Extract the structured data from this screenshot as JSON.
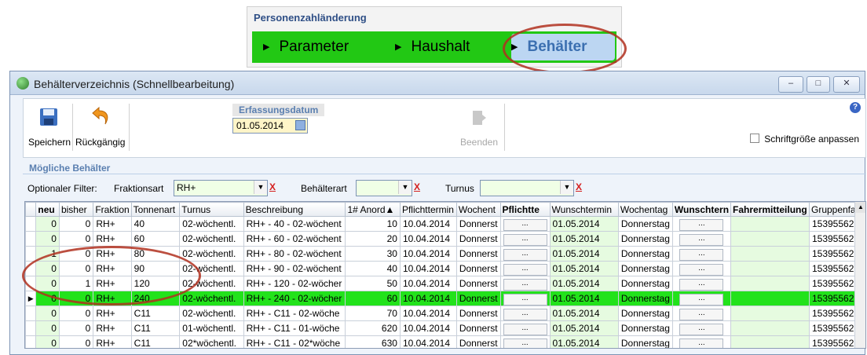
{
  "banner": {
    "title": "Personenzahländerung",
    "nav": [
      {
        "label": "Parameter"
      },
      {
        "label": "Haushalt"
      },
      {
        "label": "Behälter"
      }
    ]
  },
  "window": {
    "title": "Behälterverzeichnis (Schnellbearbeitung)",
    "controls": {
      "minimize": "–",
      "maximize": "□",
      "close": "✕"
    }
  },
  "toolbar": {
    "save_label": "Speichern",
    "undo_label": "Rückgängig",
    "exit_label": "Beenden",
    "date_label": "Erfassungsdatum",
    "date_value": "01.05.2014",
    "font_size_label": "Schriftgröße anpassen",
    "help": "?"
  },
  "section_title": "Mögliche Behälter",
  "filter": {
    "label": "Optionaler Filter:",
    "fraktionsart_label": "Fraktionsart",
    "fraktionsart_value": "RH+",
    "behaelterart_label": "Behälterart",
    "behaelterart_value": "",
    "turnus_label": "Turnus",
    "turnus_value": "",
    "clear": "X"
  },
  "grid": {
    "columns": [
      "neu",
      "bisher",
      "Fraktion",
      "Tonnenart",
      "Turnus",
      "Beschreibung",
      "1# Anord▲",
      "Pflichttermin",
      "Wochent",
      "Pflichtte",
      "Wunschtermin",
      "Wochentag",
      "Wunschtern",
      "Fahrermitteilung",
      "Gruppenfa"
    ],
    "ellipsis": "...",
    "rows": [
      {
        "neu": "0",
        "bisher": "0",
        "fraktion": "RH+",
        "tonnenart": "40",
        "turnus": "02-wöchentl.",
        "beschreibung": "RH+ - 40 - 02-wöchent",
        "anord": "10",
        "pflichttermin": "10.04.2014",
        "wochentag1": "Donnerst",
        "wunschtermin": "01.05.2014",
        "wochentag2": "Donnerstag",
        "gruppe": "15395562"
      },
      {
        "neu": "0",
        "bisher": "0",
        "fraktion": "RH+",
        "tonnenart": "60",
        "turnus": "02-wöchentl.",
        "beschreibung": "RH+ - 60 - 02-wöchent",
        "anord": "20",
        "pflichttermin": "10.04.2014",
        "wochentag1": "Donnerst",
        "wunschtermin": "01.05.2014",
        "wochentag2": "Donnerstag",
        "gruppe": "15395562"
      },
      {
        "neu": "1",
        "bisher": "0",
        "fraktion": "RH+",
        "tonnenart": "80",
        "turnus": "02-wöchentl.",
        "beschreibung": "RH+ - 80 - 02-wöchent",
        "anord": "30",
        "pflichttermin": "10.04.2014",
        "wochentag1": "Donnerst",
        "wunschtermin": "01.05.2014",
        "wochentag2": "Donnerstag",
        "gruppe": "15395562"
      },
      {
        "neu": "0",
        "bisher": "0",
        "fraktion": "RH+",
        "tonnenart": "90",
        "turnus": "02-wöchentl.",
        "beschreibung": "RH+ - 90 - 02-wöchent",
        "anord": "40",
        "pflichttermin": "10.04.2014",
        "wochentag1": "Donnerst",
        "wunschtermin": "01.05.2014",
        "wochentag2": "Donnerstag",
        "gruppe": "15395562"
      },
      {
        "neu": "0",
        "bisher": "1",
        "fraktion": "RH+",
        "tonnenart": "120",
        "turnus": "02-wöchentl.",
        "beschreibung": "RH+ - 120 - 02-wöcher",
        "anord": "50",
        "pflichttermin": "10.04.2014",
        "wochentag1": "Donnerst",
        "wunschtermin": "01.05.2014",
        "wochentag2": "Donnerstag",
        "gruppe": "15395562"
      },
      {
        "neu": "0",
        "bisher": "0",
        "fraktion": "RH+",
        "tonnenart": "240",
        "turnus": "02-wöchentl.",
        "beschreibung": "RH+ - 240 - 02-wöcher",
        "anord": "60",
        "pflichttermin": "10.04.2014",
        "wochentag1": "Donnerst",
        "wunschtermin": "01.05.2014",
        "wochentag2": "Donnerstag",
        "gruppe": "15395562",
        "selected": true
      },
      {
        "neu": "0",
        "bisher": "0",
        "fraktion": "RH+",
        "tonnenart": "C11",
        "turnus": "02-wöchentl.",
        "beschreibung": "RH+ - C11 - 02-wöche",
        "anord": "70",
        "pflichttermin": "10.04.2014",
        "wochentag1": "Donnerst",
        "wunschtermin": "01.05.2014",
        "wochentag2": "Donnerstag",
        "gruppe": "15395562"
      },
      {
        "neu": "0",
        "bisher": "0",
        "fraktion": "RH+",
        "tonnenart": "C11",
        "turnus": "01-wöchentl.",
        "beschreibung": "RH+ - C11 - 01-wöche",
        "anord": "620",
        "pflichttermin": "10.04.2014",
        "wochentag1": "Donnerst",
        "wunschtermin": "01.05.2014",
        "wochentag2": "Donnerstag",
        "gruppe": "15395562"
      },
      {
        "neu": "0",
        "bisher": "0",
        "fraktion": "RH+",
        "tonnenart": "C11",
        "turnus": "02*wöchentl.",
        "beschreibung": "RH+ - C11 - 02*wöche",
        "anord": "630",
        "pflichttermin": "10.04.2014",
        "wochentag1": "Donnerst",
        "wunschtermin": "01.05.2014",
        "wochentag2": "Donnerstag",
        "gruppe": "15395562"
      }
    ]
  },
  "colors": {
    "accent_green": "#22c814",
    "selected_row": "#22e21b",
    "annotation": "#b0301f"
  }
}
